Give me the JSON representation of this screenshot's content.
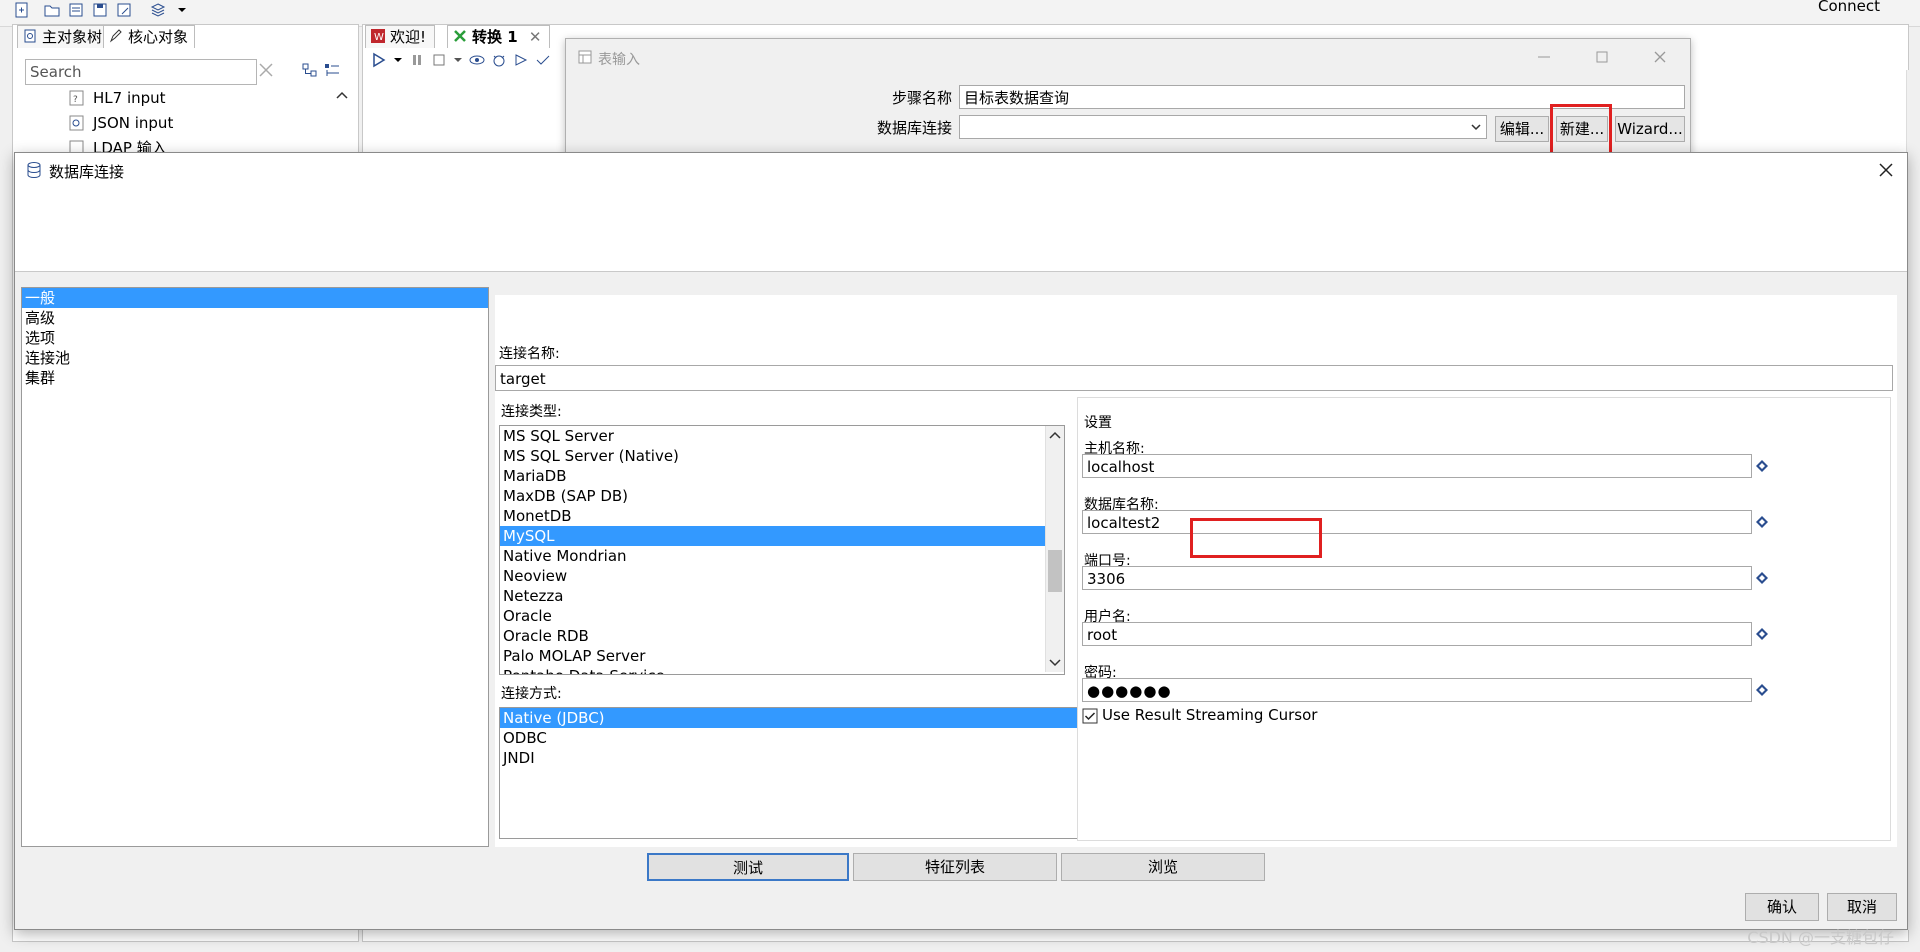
{
  "background": {
    "connect_label": "Connect",
    "left_tabs": [
      "主对象树",
      "核心对象"
    ],
    "search_placeholder": "Search",
    "tree_items": [
      "HL7 input",
      "JSON input",
      "LDAP 输入"
    ],
    "editor_tabs": [
      "欢迎!",
      "转换 1"
    ]
  },
  "table_input_dialog": {
    "title": "表输入",
    "step_name_label": "步骤名称",
    "step_name_value": "目标表数据查询",
    "db_conn_label": "数据库连接",
    "db_conn_value": "",
    "edit_button": "编辑...",
    "new_button": "新建...",
    "wizard_button": "Wizard..."
  },
  "db_dialog": {
    "title": "数据库连接",
    "nav_items": [
      "一般",
      "高级",
      "选项",
      "连接池",
      "集群"
    ],
    "selected_nav": "一般",
    "conn_name_label": "连接名称:",
    "conn_name_value": "target",
    "conn_type_label": "连接类型:",
    "conn_types": [
      "MS SQL Server",
      "MS SQL Server (Native)",
      "MariaDB",
      "MaxDB (SAP DB)",
      "MonetDB",
      "MySQL",
      "Native Mondrian",
      "Neoview",
      "Netezza",
      "Oracle",
      "Oracle RDB",
      "Palo MOLAP Server",
      "Pentaho Data Service"
    ],
    "selected_conn_type": "MySQL",
    "access_label": "连接方式:",
    "access_types": [
      "Native (JDBC)",
      "ODBC",
      "JNDI"
    ],
    "selected_access": "Native (JDBC)",
    "settings_label": "设置",
    "host_label": "主机名称:",
    "host_value": "localhost",
    "dbname_label": "数据库名称:",
    "dbname_value": "localtest2",
    "port_label": "端口号:",
    "port_value": "3306",
    "user_label": "用户名:",
    "user_value": "root",
    "password_label": "密码:",
    "password_value": "●●●●●●",
    "streaming_label": "Use Result Streaming Cursor",
    "streaming_checked": true,
    "test_button": "测试",
    "features_button": "特征列表",
    "explore_button": "浏览",
    "ok_button": "确认",
    "cancel_button": "取消"
  },
  "watermark": "CSDN @一支糖包仔",
  "colors": {
    "selection": "#3399ff",
    "highlight_box": "#e02020"
  }
}
